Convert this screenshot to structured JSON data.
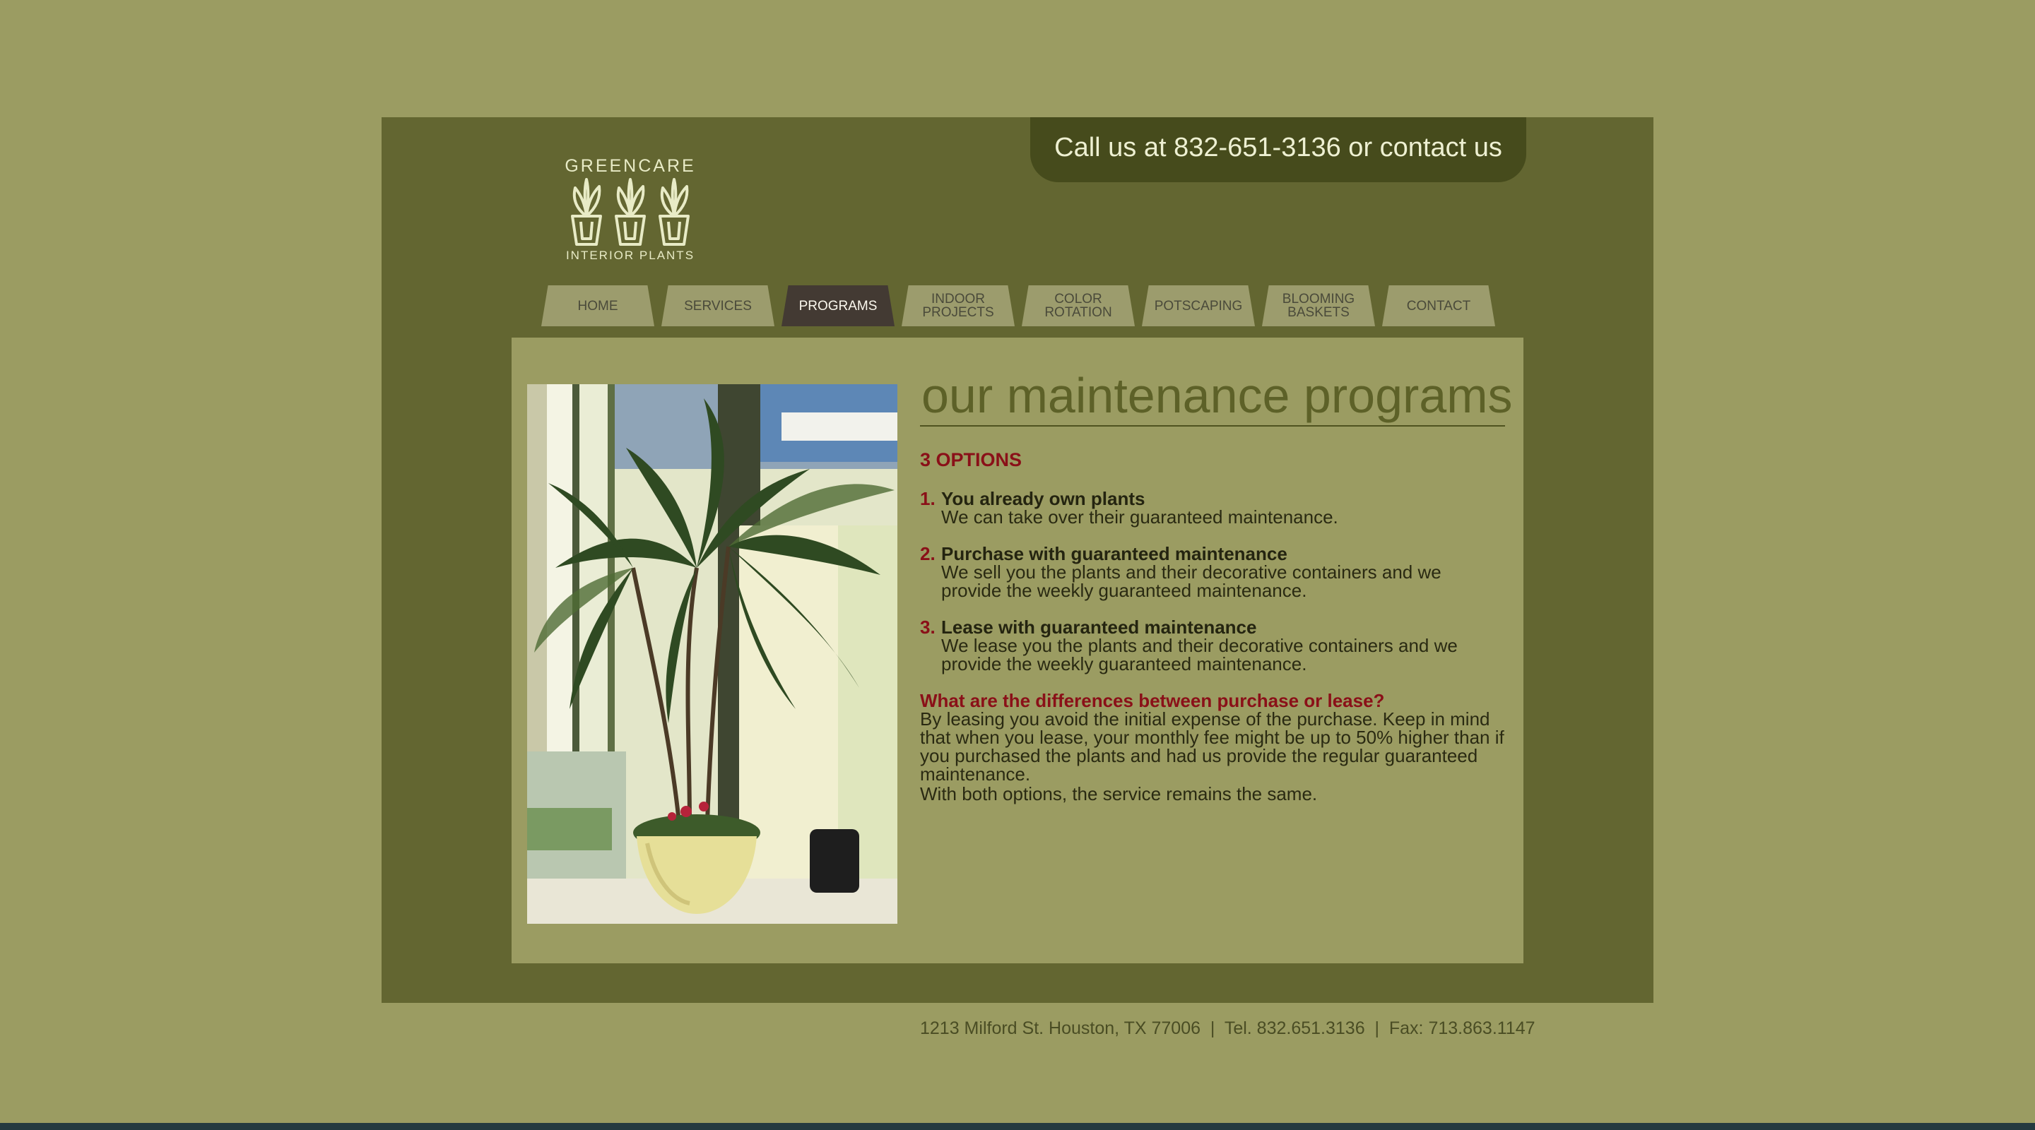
{
  "header": {
    "call_text": "Call us at 832-651-3136 or contact us",
    "logo_brand": "GREENCARE",
    "logo_tagline": "INTERIOR PLANTS"
  },
  "nav": {
    "items": [
      {
        "label": "HOME",
        "active": false
      },
      {
        "label": "SERVICES",
        "active": false
      },
      {
        "label": "PROGRAMS",
        "active": true
      },
      {
        "label": "INDOOR\nPROJECTS",
        "active": false
      },
      {
        "label": "COLOR\nROTATION",
        "active": false
      },
      {
        "label": "POTSCAPING",
        "active": false
      },
      {
        "label": "BLOOMING\nBASKETS",
        "active": false
      },
      {
        "label": "CONTACT",
        "active": false
      }
    ]
  },
  "main": {
    "heading": "our maintenance programs",
    "options_title": "3 OPTIONS",
    "options": [
      {
        "num": "1.",
        "title": "You already own plants",
        "desc": "We can take over their guaranteed maintenance."
      },
      {
        "num": "2.",
        "title": "Purchase with guaranteed maintenance",
        "desc": "We sell you the plants and their decorative containers and we provide the weekly guaranteed maintenance."
      },
      {
        "num": "3.",
        "title": "Lease with guaranteed maintenance",
        "desc": "We lease you the plants and their decorative containers and we provide the weekly guaranteed maintenance."
      }
    ],
    "question": "What are the differences between purchase or lease?",
    "answer": "By leasing you avoid the initial expense of the purchase. Keep in mind that when you lease, your monthly fee might be up to 50% higher than if you purchased the plants and had us provide the regular guaranteed maintenance.",
    "closing": "With both options, the service remains the same."
  },
  "footer": {
    "text": "1213 Milford St. Houston, TX 77006  |  Tel. 832.651.3136  |  Fax: 713.863.1147"
  },
  "colors": {
    "page_bg": "#9b9c62",
    "frame": "#636631",
    "call_tab": "#464b1c",
    "nav_tab": "#9c9c6d",
    "nav_active": "#433a33",
    "accent_red": "#8a1018"
  },
  "photo": {
    "subject": "potted-palm-photo"
  }
}
